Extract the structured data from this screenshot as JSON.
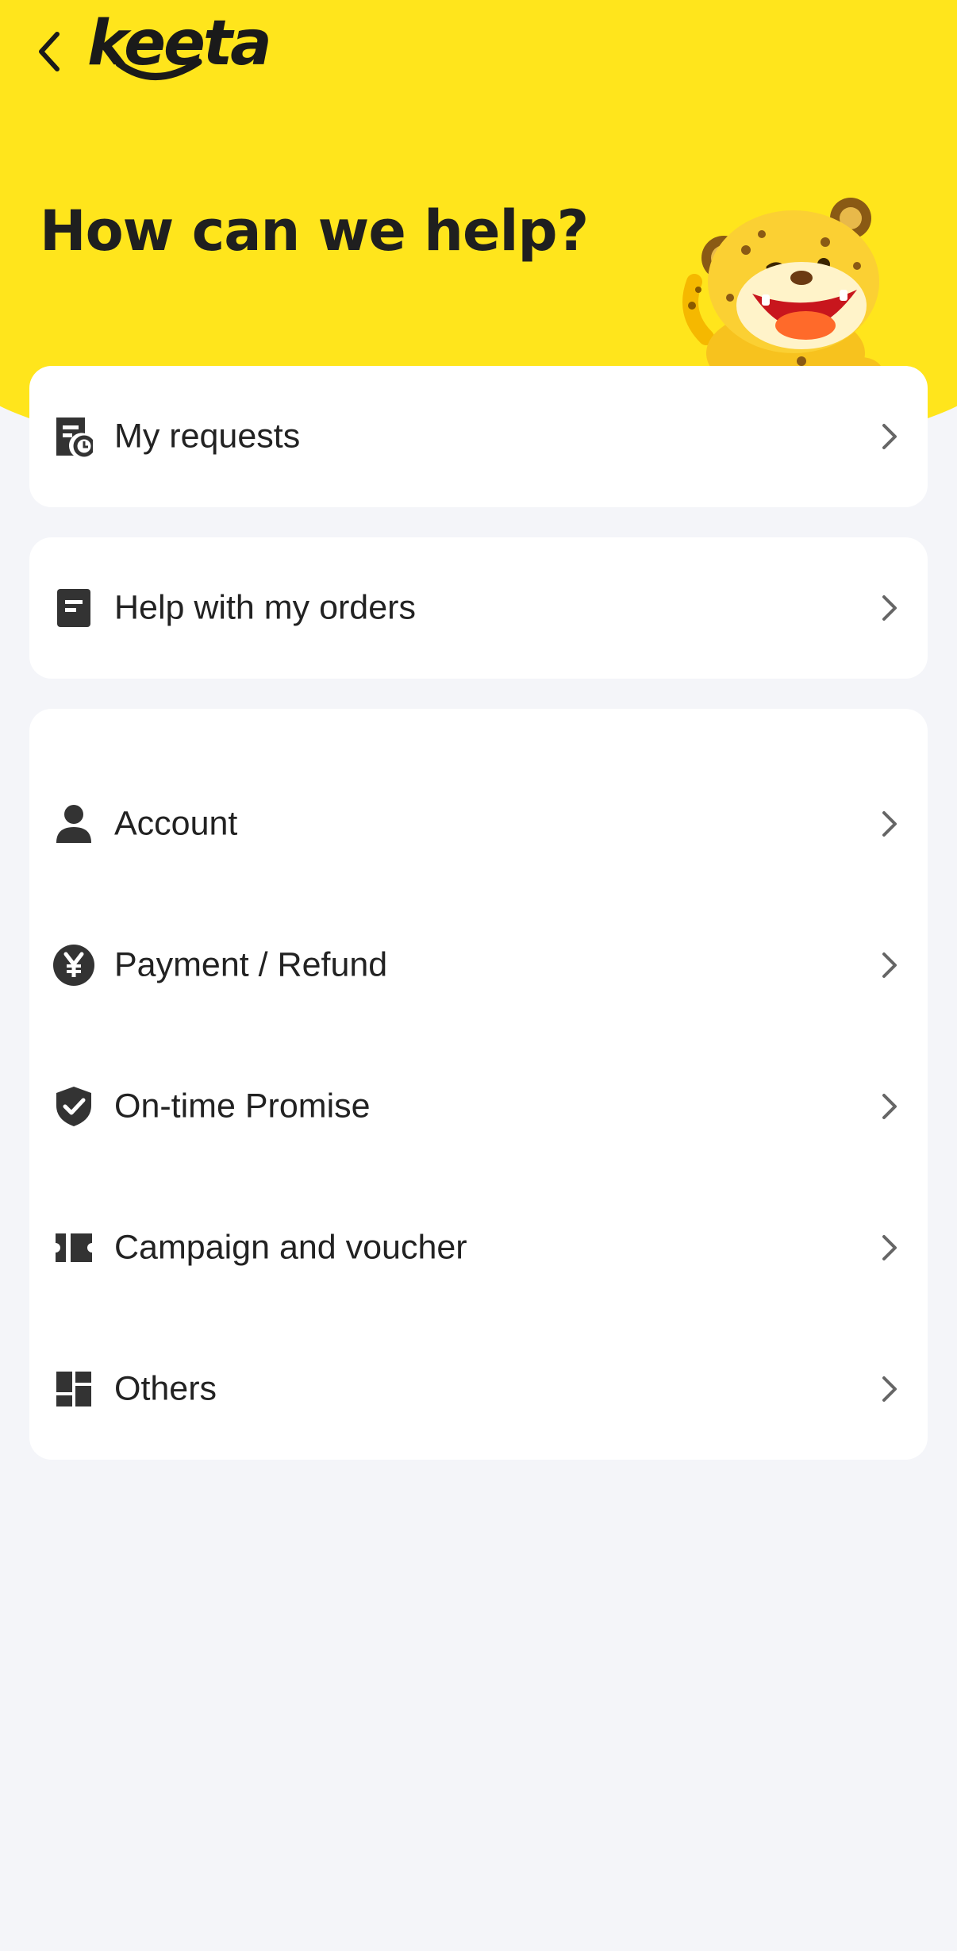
{
  "app": {
    "logo_text": "keeta"
  },
  "header": {
    "title": "How can we help?"
  },
  "icons": {
    "back": "chevron-left-icon",
    "requests": "receipt-clock-icon",
    "orders": "document-icon",
    "account": "person-icon",
    "payment": "yen-coin-icon",
    "promise": "shield-check-icon",
    "campaign": "ticket-icon",
    "others": "grid-icon",
    "chevron": "chevron-right-icon"
  },
  "colors": {
    "brand_yellow": "#ffe51c",
    "background": "#f4f5f9",
    "text": "#222222"
  },
  "cards": {
    "requests": {
      "label": "My requests"
    },
    "orders": {
      "label": "Help with my orders"
    },
    "topics": [
      {
        "label": "Account"
      },
      {
        "label": "Payment / Refund"
      },
      {
        "label": "On-time Promise"
      },
      {
        "label": "Campaign and voucher"
      },
      {
        "label": "Others"
      }
    ]
  }
}
